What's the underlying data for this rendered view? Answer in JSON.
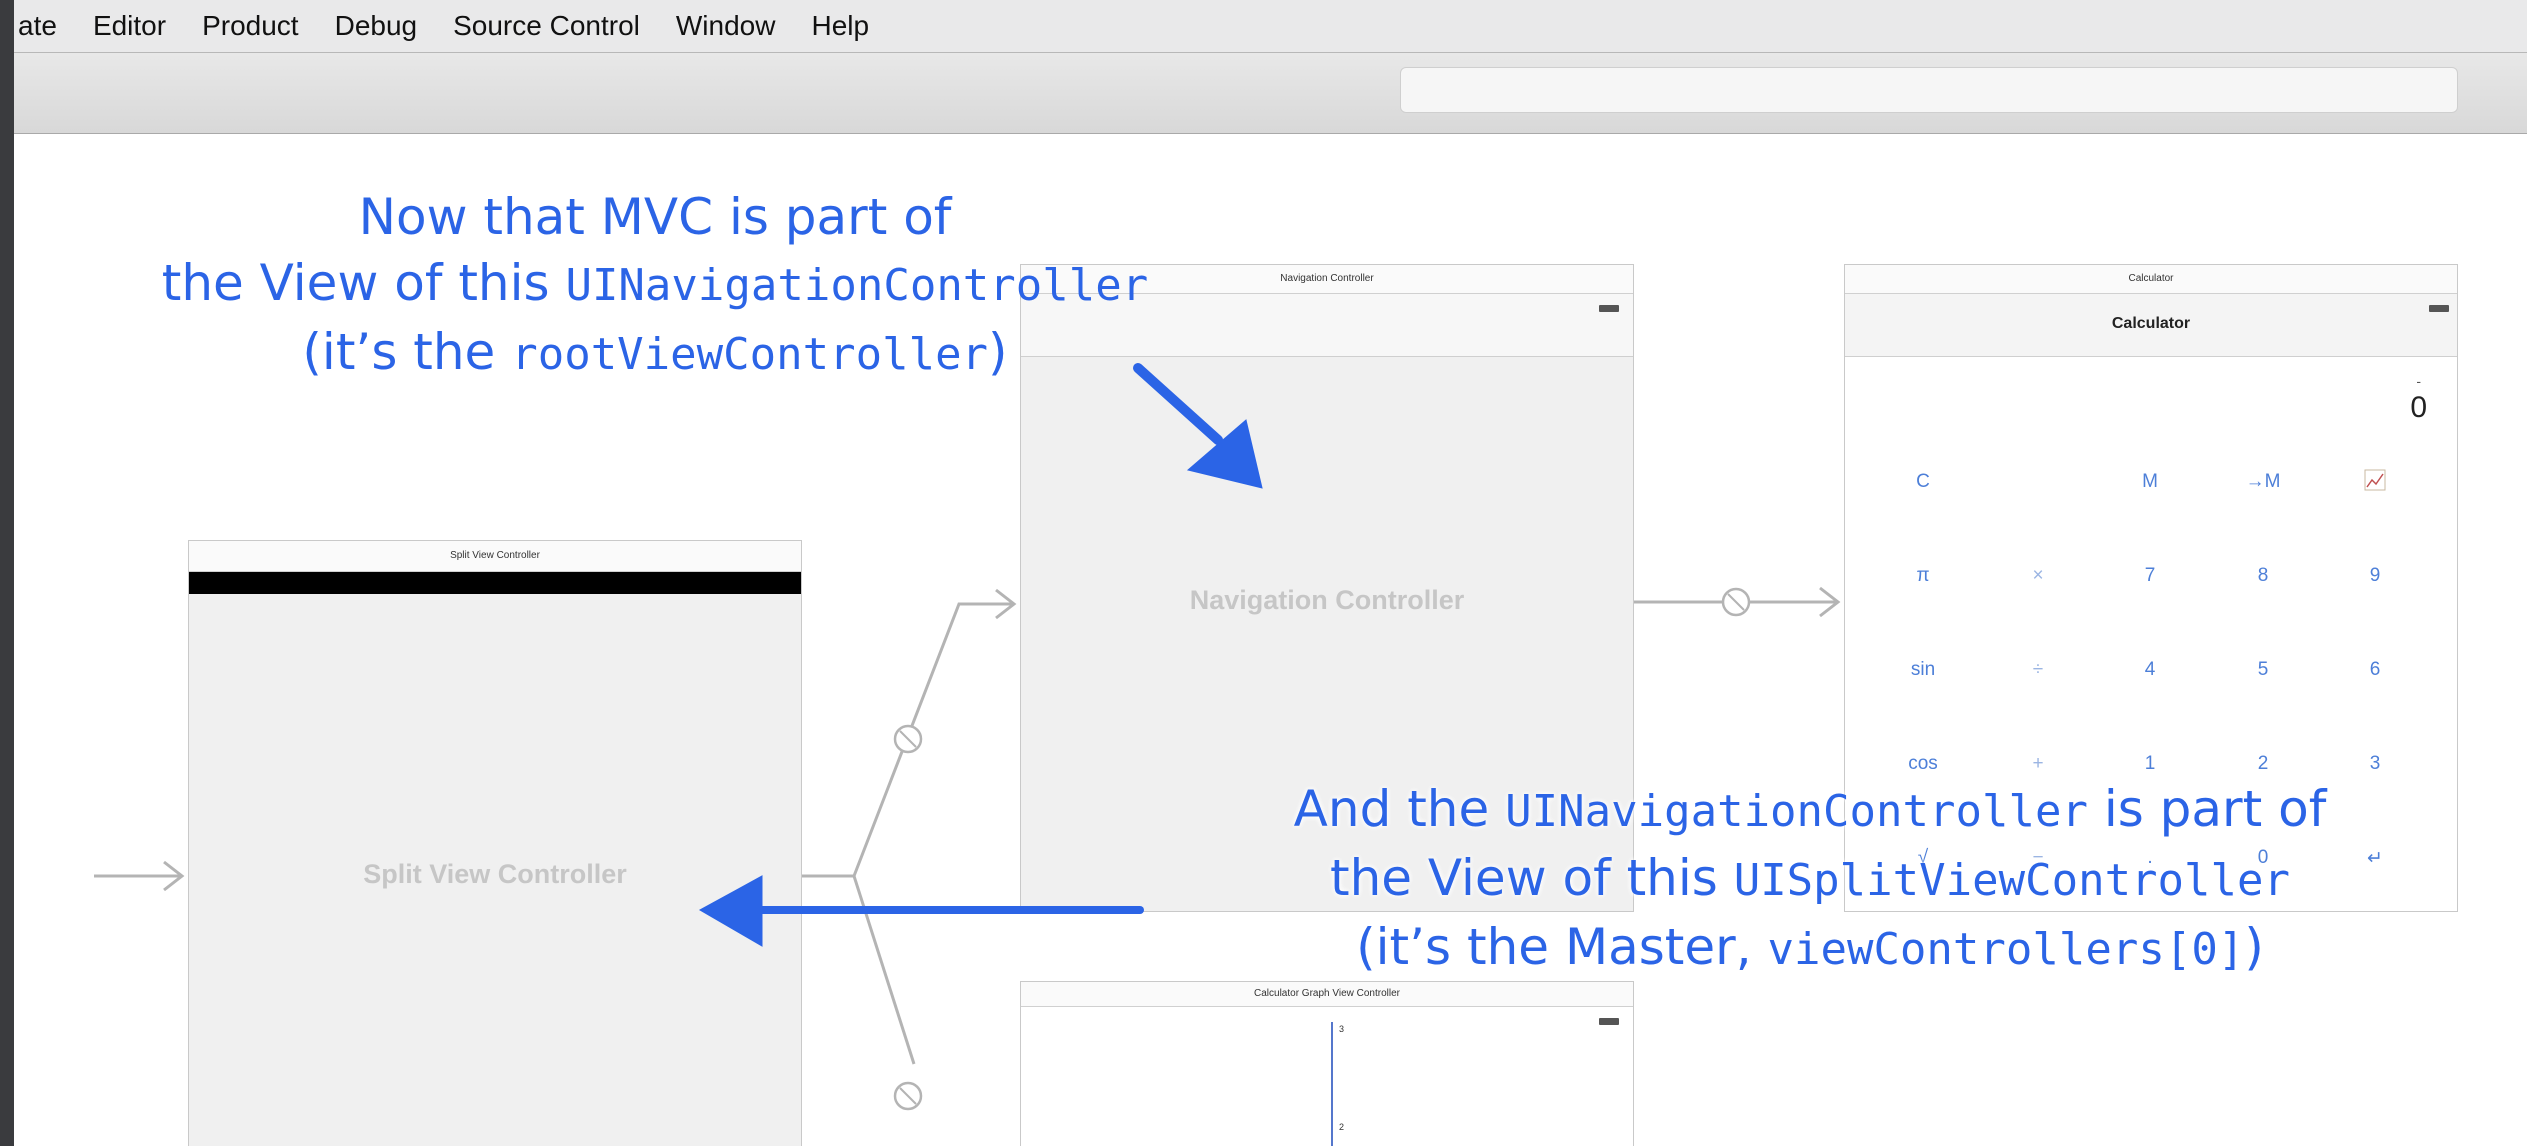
{
  "menubar": {
    "items": [
      "ate",
      "Editor",
      "Product",
      "Debug",
      "Source Control",
      "Window",
      "Help"
    ]
  },
  "split_view": {
    "title": "Split View Controller",
    "center_label": "Split View Controller"
  },
  "nav_view": {
    "title": "Navigation Controller",
    "center_label": "Navigation Controller"
  },
  "calc_view": {
    "title": "Calculator",
    "nav_title": "Calculator",
    "minus": "-",
    "display": "0",
    "keys": [
      [
        "C",
        "",
        "M",
        "→M",
        "chart-icon"
      ],
      [
        "π",
        "×",
        "7",
        "8",
        "9"
      ],
      [
        "sin",
        "÷",
        "4",
        "5",
        "6"
      ],
      [
        "cos",
        "+",
        "1",
        "2",
        "3"
      ],
      [
        "√",
        "−",
        ".",
        "0",
        "↵"
      ]
    ]
  },
  "graph_view": {
    "title": "Calculator Graph View Controller",
    "ticks": [
      "3",
      "2"
    ]
  },
  "annotation_top": {
    "line1": "Now that MVC is part of",
    "line2_a": "the View of this ",
    "line2_b": "UINavigationController",
    "line3_a": "(it’s the ",
    "line3_b": "rootViewController",
    "line3_c": ")"
  },
  "annotation_bottom": {
    "line1_a": "And the ",
    "line1_b": "UINavigationController",
    "line1_c": " is part of",
    "line2_a": "the View of this ",
    "line2_b": "UISplitViewController",
    "line3_a": "(it’s the Master, ",
    "line3_b": "viewControllers[0]",
    "line3_c": ")"
  },
  "colors": {
    "annotation": "#2b64e6",
    "background": "#3a3b3e",
    "canvas": "#ffffff"
  }
}
